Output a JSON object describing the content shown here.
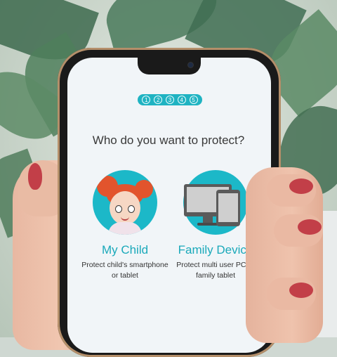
{
  "steps": [
    "1",
    "2",
    "3",
    "4",
    "5"
  ],
  "question": "Who do you want to protect?",
  "options": [
    {
      "title": "My Child",
      "description_line1": "Protect child's smartphone",
      "description_line2": "or tablet",
      "icon": "child-illustration-icon"
    },
    {
      "title": "Family Device",
      "description_line1": "Protect multi user PC or",
      "description_line2": "family tablet",
      "icon": "computer-tablet-illustration-icon"
    }
  ],
  "colors": {
    "accent": "#1fb3c2",
    "title_text": "#1aa9ba",
    "screen_bg": "#f1f5f8",
    "nail_polish": "#c23f48"
  }
}
